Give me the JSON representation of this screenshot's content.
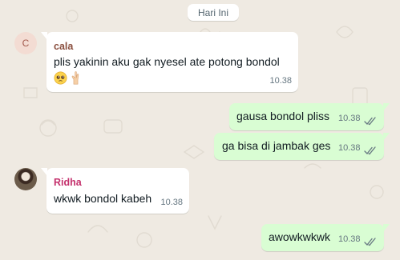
{
  "date_chip": "Hari Ini",
  "colors": {
    "background": "#efeae2",
    "incoming": "#ffffff",
    "outgoing": "#d9fdd3",
    "sender_cala": "#8a4f3f",
    "sender_ridha": "#c4306c",
    "read_ticks": "#667781"
  },
  "messages": [
    {
      "direction": "in",
      "sender": "cala",
      "avatar_initial": "C",
      "text": "plis yakinin aku gak nyesel ate potong bondol",
      "emojis": [
        "pleading-face-emoji",
        "crossed-fingers-emoji"
      ],
      "time": "10.38"
    },
    {
      "direction": "out",
      "text": "gausa bondol pliss",
      "time": "10.38",
      "status": "read-double-check"
    },
    {
      "direction": "out",
      "text": "ga bisa di jambak ges",
      "time": "10.38",
      "status": "read-double-check"
    },
    {
      "direction": "in",
      "sender": "Ridha",
      "avatar": "profile-photo",
      "text": "wkwk bondol kabeh",
      "time": "10.38"
    },
    {
      "direction": "out",
      "text": "awowkwkwk",
      "time": "10.38",
      "status": "read-double-check"
    }
  ]
}
